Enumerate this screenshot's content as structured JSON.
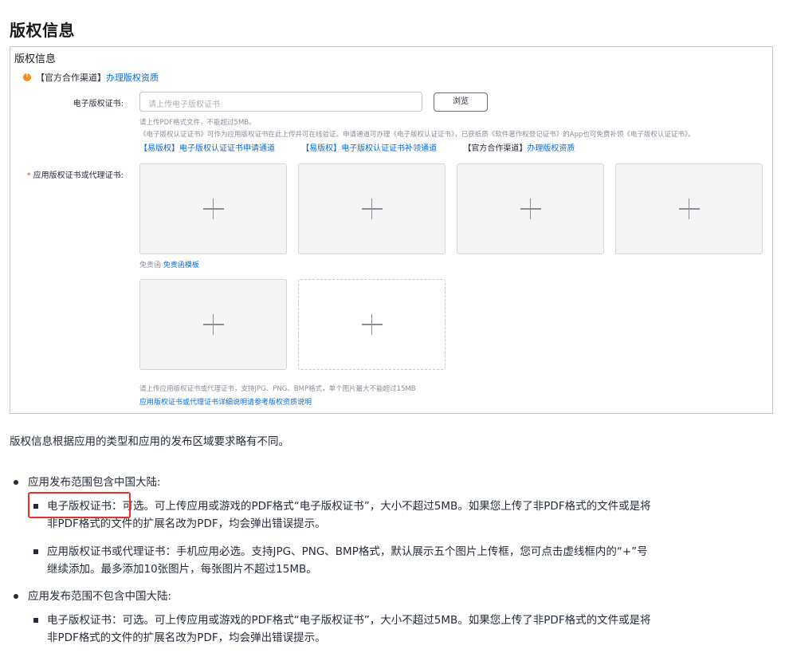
{
  "page_title": "版权信息",
  "panel": {
    "title": "版权信息",
    "notice_tag": "【官方合作渠道】",
    "notice_link": "办理版权资质",
    "ecert_label": "电子版权证书:",
    "ecert_placeholder": "请上传电子版权证书",
    "browse_label": "浏览",
    "hint1": "请上传PDF格式文件，不能超过5MB。",
    "hint2": "《电子版权认证证书》可作为应用版权证书在此上传并可在线验证。申请通道可办理《电子版权认证证书》，已获纸质《软件著作权登记证书》的App也可免费补领《电子版权认证证书》。",
    "links": [
      {
        "tag": "【易版权】",
        "text": "电子版权认证证书申请通道"
      },
      {
        "tag": "【易版权】",
        "text": "电子版权认证证书补领通道"
      },
      {
        "tag": "【官方合作渠道】",
        "text": "办理版权资质"
      }
    ],
    "app_cert_label": "应用版权证书或代理证书:",
    "disclaimer_prefix": "免责函",
    "disclaimer_link": "免责函模板",
    "upload_hint": "请上传应用版权证书或代理证书，支持JPG、PNG、BMP格式，单个图片最大不能超过15MB",
    "upload_link": "应用版权证书或代理证书详细说明请参考版权资质说明"
  },
  "intro": "版权信息根据应用的类型和应用的发布区域要求略有不同。",
  "sections": [
    {
      "title": "应用发布范围包含中国大陆:",
      "items": [
        {
          "line1": "电子版权证书：可选。可上传应用或游戏的PDF格式“电子版权证书”，大小不超过5MB。如果您上传了非PDF格式的文件或是将",
          "line2": "非PDF格式的文件的扩展名改为PDF，均会弹出错误提示。"
        },
        {
          "line1": "应用版权证书或代理证书：手机应用必选。支持JPG、PNG、BMP格式，默认展示五个图片上传框，您可点击虚线框内的“+”号",
          "line2": "继续添加。最多添加10张图片，每张图片不超过15MB。"
        }
      ]
    },
    {
      "title": "应用发布范围不包含中国大陆:",
      "items": [
        {
          "line1": "电子版权证书：可选。可上传应用或游戏的PDF格式“电子版权证书”，大小不超过5MB。如果您上传了非PDF格式的文件或是将",
          "line2": "非PDF格式的文件的扩展名改为PDF，均会弹出错误提示。"
        }
      ]
    }
  ],
  "colors": {
    "link": "#0a6bd8",
    "highlight": "#e5312b",
    "warning": "#fa8c16"
  }
}
